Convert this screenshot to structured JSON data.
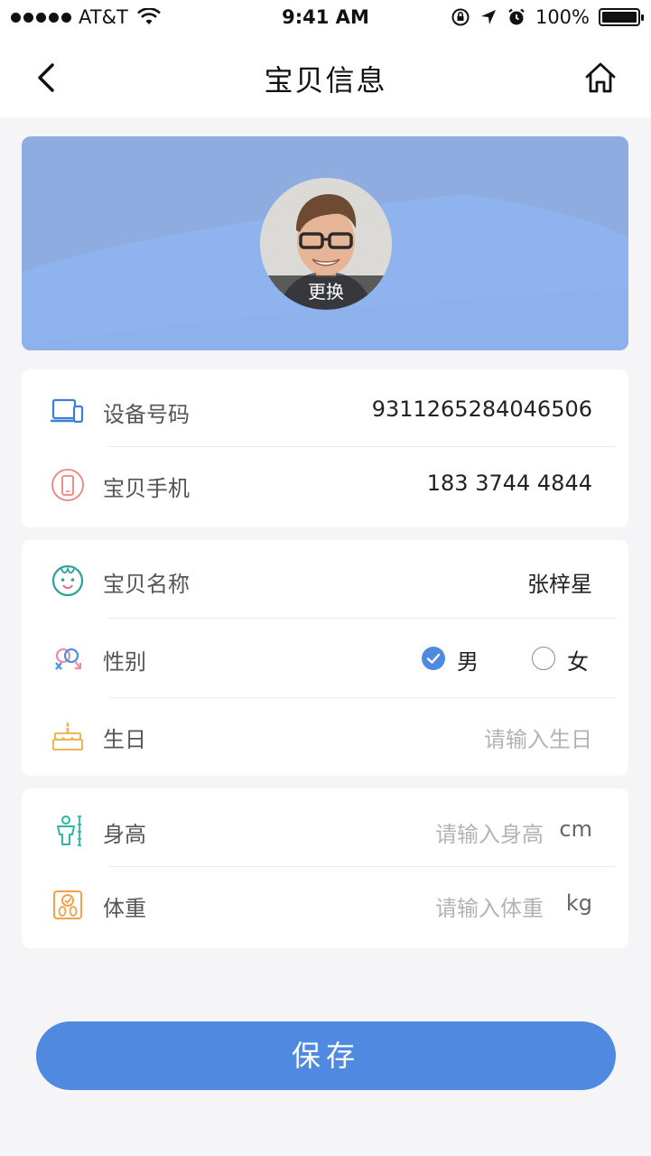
{
  "status_bar": {
    "carrier": "AT&T",
    "time": "9:41 AM",
    "battery": "100%"
  },
  "nav": {
    "title": "宝贝信息",
    "back_icon": "chevron-left-icon",
    "home_icon": "home-icon"
  },
  "banner": {
    "avatar_change_label": "更换"
  },
  "device": {
    "device_number_label": "设备号码",
    "device_number_value": "9311265284046506",
    "baby_phone_label": "宝贝手机",
    "baby_phone_value": "183 3744 4844"
  },
  "profile": {
    "name_label": "宝贝名称",
    "name_value": "张梓星",
    "gender_label": "性别",
    "gender_male": "男",
    "gender_female": "女",
    "gender_selected": "男",
    "birthday_label": "生日",
    "birthday_placeholder": "请输入生日"
  },
  "body": {
    "height_label": "身高",
    "height_placeholder": "请输入身高",
    "height_unit": "cm",
    "weight_label": "体重",
    "weight_placeholder": "请输入体重",
    "weight_unit": "kg"
  },
  "save_label": "保存",
  "colors": {
    "accent": "#508ae0",
    "banner": "#8eacdf"
  }
}
